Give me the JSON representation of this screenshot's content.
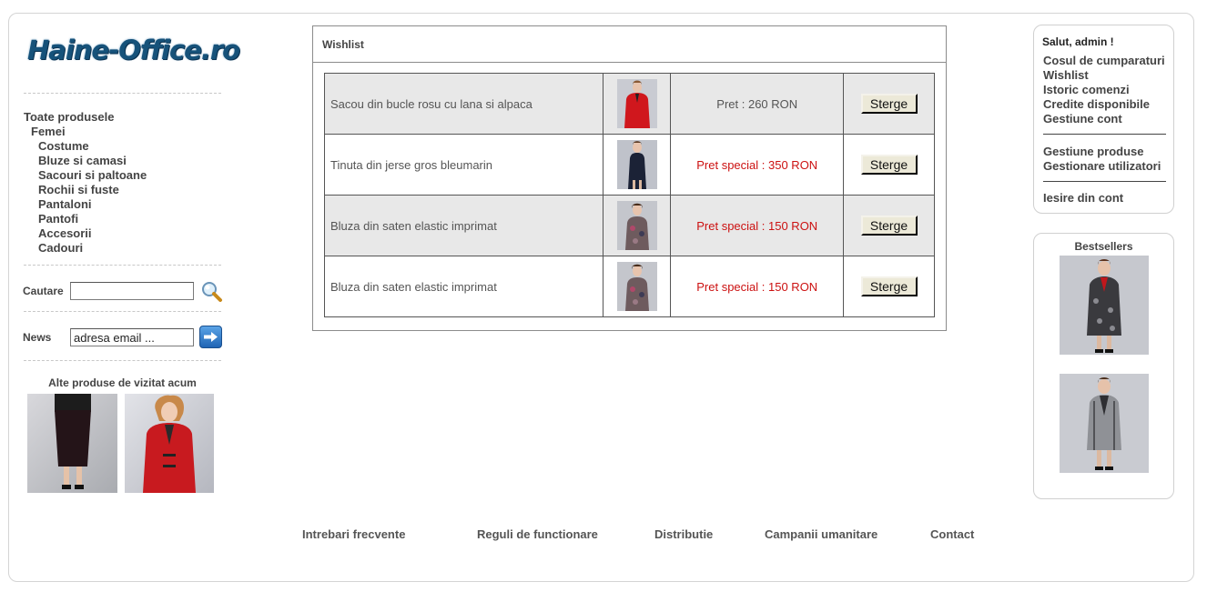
{
  "logo": {
    "text": "Haine-Office.ro"
  },
  "categories": {
    "all": "Toate produsele",
    "group": "Femei",
    "items": [
      "Costume",
      "Bluze si camasi",
      "Sacouri si paltoane",
      "Rochii si fuste",
      "Pantaloni",
      "Pantofi",
      "Accesorii",
      "Cadouri"
    ]
  },
  "search": {
    "label": "Cautare",
    "value": "",
    "icon": "search-icon"
  },
  "news": {
    "label": "News",
    "value": "adresa email ...",
    "icon": "arrow-right-icon"
  },
  "other_products": {
    "title": "Alte produse de vizitat acum"
  },
  "wishlist": {
    "title": "Wishlist",
    "button_label": "Sterge",
    "rows": [
      {
        "name": "Sacou din bucle rosu cu lana si alpaca",
        "price": "Pret : 260 RON",
        "special": false
      },
      {
        "name": "Tinuta din jerse gros bleumarin",
        "price": "Pret special : 350 RON",
        "special": true
      },
      {
        "name": "Bluza din saten elastic imprimat",
        "price": "Pret special : 150 RON",
        "special": true
      },
      {
        "name": "Bluza din saten elastic imprimat",
        "price": "Pret special : 150 RON",
        "special": true
      }
    ]
  },
  "user": {
    "greeting": "Salut, admin !",
    "links_a": [
      "Cosul de cumparaturi",
      "Wishlist",
      "Istoric comenzi",
      "Credite disponibile",
      "Gestiune cont"
    ],
    "links_b": [
      "Gestiune produse",
      "Gestionare utilizatori"
    ],
    "logout": "Iesire din cont"
  },
  "bestsellers": {
    "title": "Bestsellers"
  },
  "footer": [
    "Intrebari frecvente",
    "Reguli de functionare",
    "Distributie",
    "Campanii umanitare",
    "Contact"
  ],
  "colors": {
    "special_price": "#cc1111",
    "logo": "#16527a"
  }
}
